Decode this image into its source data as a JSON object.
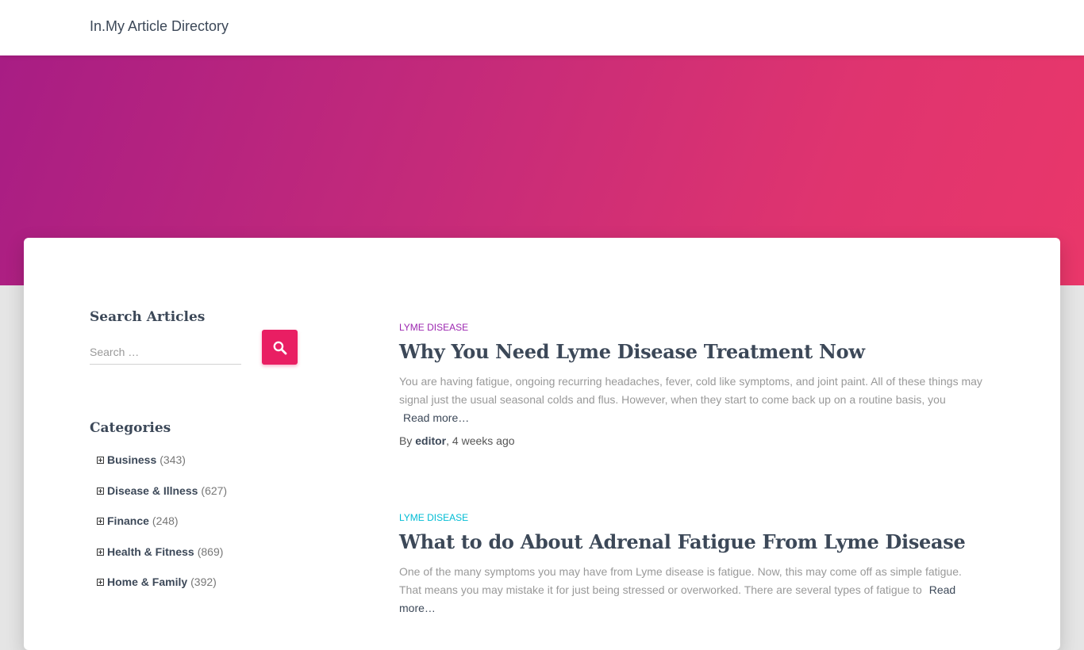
{
  "site": {
    "title": "In.My Article Directory"
  },
  "sidebar": {
    "search": {
      "title": "Search Articles",
      "placeholder": "Search …"
    },
    "categories": {
      "title": "Categories",
      "items": [
        {
          "name": "Business",
          "count": "(343)"
        },
        {
          "name": "Disease & Illness",
          "count": "(627)"
        },
        {
          "name": "Finance",
          "count": "(248)"
        },
        {
          "name": "Health & Fitness",
          "count": "(869)"
        },
        {
          "name": "Home & Family",
          "count": "(392)"
        }
      ]
    }
  },
  "articles": [
    {
      "category": "LYME DISEASE",
      "title": "Why You Need Lyme Disease Treatment Now",
      "excerpt": "You are having fatigue, ongoing recurring headaches, fever, cold like symptoms, and joint paint. All of these things may signal just the usual seasonal colds and flus. However, when they start to come back up on a routine basis, you",
      "read_more": "Read more…",
      "by": "By",
      "author": "editor",
      "time": ", 4 weeks ago"
    },
    {
      "category": "LYME DISEASE",
      "title": "What to do About Adrenal Fatigue From Lyme Disease",
      "excerpt": "One of the many symptoms you may have from Lyme disease is fatigue. Now, this may come off as simple fatigue. That means you may mistake it for just being stressed or overworked. There are several types of fatigue to",
      "read_more": "Read more…"
    }
  ],
  "colors": {
    "accent": "#e91e63",
    "category_purple": "#9c27b0",
    "category_teal": "#00bcd4",
    "heading": "#3c4858"
  },
  "icons": {
    "search_button": "search-icon",
    "category_expand": "plus-square-icon"
  }
}
